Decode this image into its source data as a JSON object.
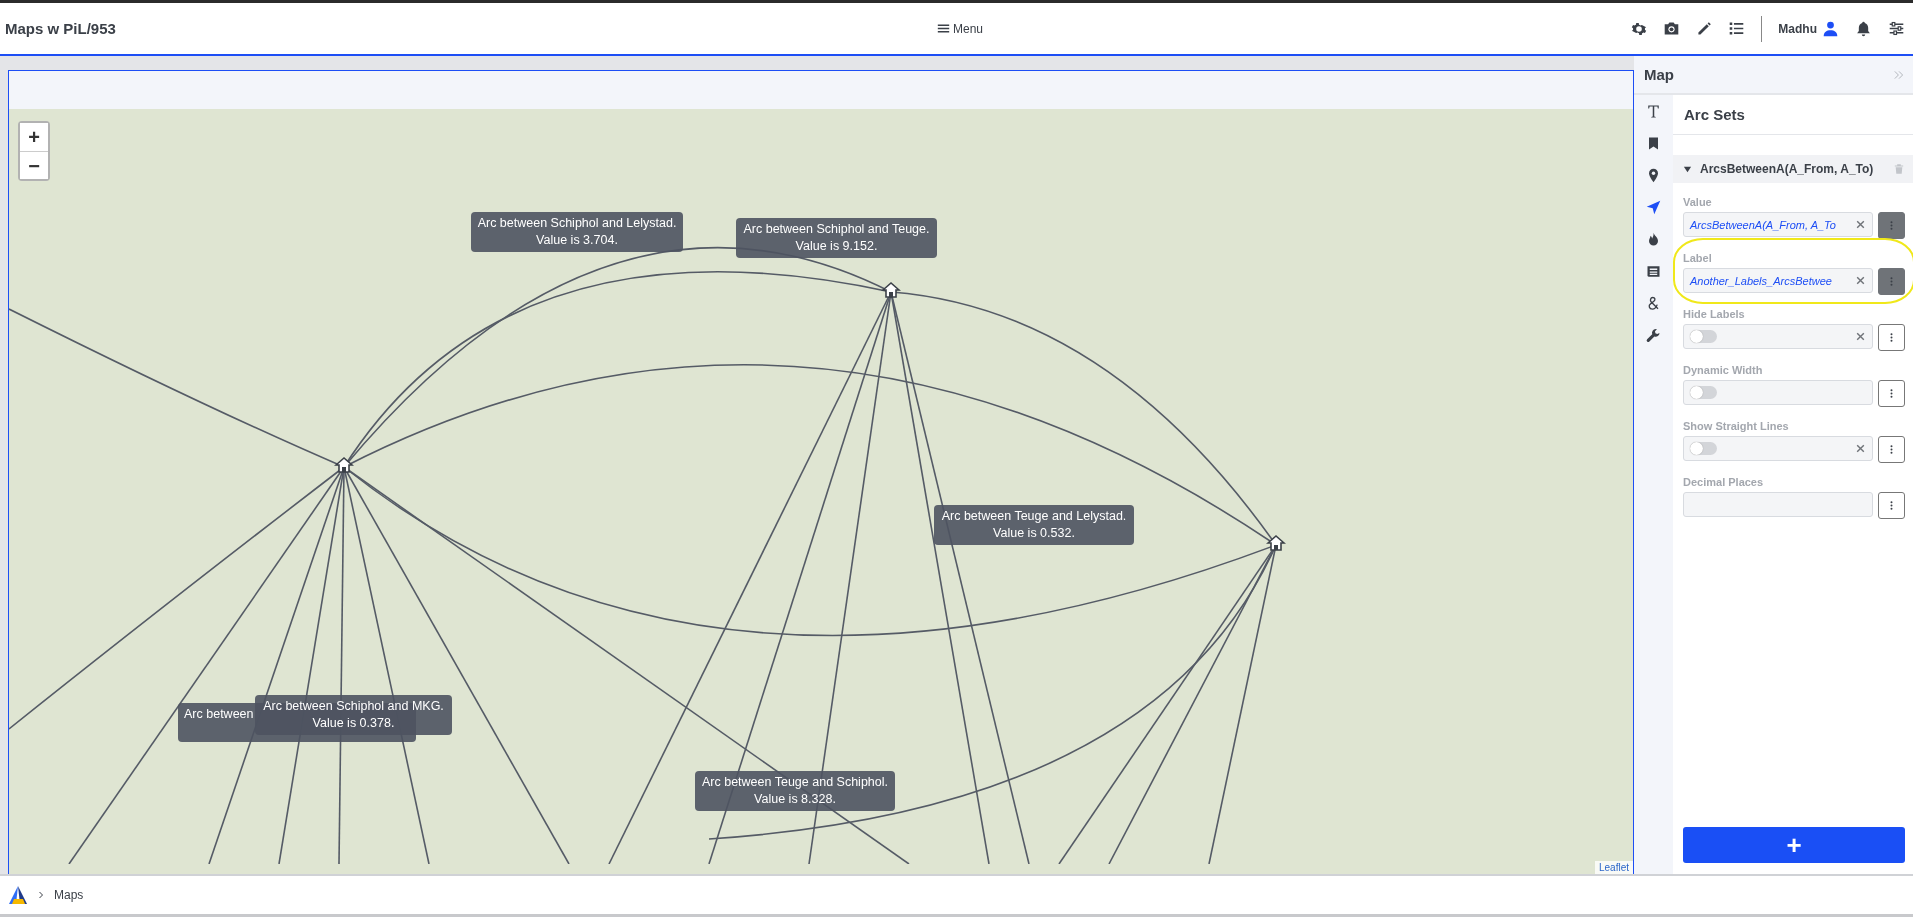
{
  "app": {
    "title": "Maps w PiL/953",
    "menu_label": "Menu",
    "user_name": "Madhu"
  },
  "map": {
    "zoom_in": "+",
    "zoom_out": "−",
    "attribution": "Leaflet",
    "tooltips": [
      {
        "lines": [
          "Arc between Schiphol and Lelystad.",
          "Value is 3.704."
        ]
      },
      {
        "lines": [
          "Arc between Schiphol and Teuge.",
          "Value is 9.152."
        ]
      },
      {
        "lines": [
          "Arc between Teuge and Lelystad.",
          "Value is 0.532."
        ]
      },
      {
        "lines": [
          "Arc between"
        ]
      },
      {
        "lines": [
          "Arc between Schiphol and MKG.",
          "Value is 0.378."
        ]
      },
      {
        "lines": [
          "Arc between Teuge and Schiphol.",
          "Value is 8.328."
        ]
      }
    ]
  },
  "panel": {
    "title": "Map",
    "section_title": "Arc Sets",
    "add_button": "+",
    "rail": [
      {
        "kind": "text",
        "selected": false
      },
      {
        "kind": "bookmark",
        "selected": false
      },
      {
        "kind": "pin",
        "selected": false
      },
      {
        "kind": "arrow",
        "selected": true
      },
      {
        "kind": "fire",
        "selected": false
      },
      {
        "kind": "news",
        "selected": false
      },
      {
        "kind": "ampersand",
        "selected": false
      },
      {
        "kind": "wrench",
        "selected": false
      }
    ],
    "arc_set": {
      "name": "ArcsBetweenA(A_From, A_To)",
      "expanded": true
    },
    "fields": [
      {
        "label": "Value",
        "kind": "text",
        "value": "ArcsBetweenA(A_From, A_To",
        "clearable": true,
        "bound": true,
        "highlighted": false
      },
      {
        "label": "Label",
        "kind": "text",
        "value": "Another_Labels_ArcsBetwee",
        "clearable": true,
        "bound": true,
        "highlighted": true
      },
      {
        "label": "Hide Labels",
        "kind": "toggle",
        "on": false,
        "clearable": true,
        "bound": false,
        "highlighted": false
      },
      {
        "label": "Dynamic Width",
        "kind": "toggle",
        "on": false,
        "clearable": false,
        "bound": false,
        "highlighted": false
      },
      {
        "label": "Show Straight Lines",
        "kind": "toggle",
        "on": false,
        "clearable": true,
        "bound": false,
        "highlighted": false
      },
      {
        "label": "Decimal Places",
        "kind": "text",
        "clearable": false,
        "bound": false,
        "highlighted": false
      }
    ]
  },
  "breadcrumb": {
    "items": [
      "Maps"
    ]
  }
}
